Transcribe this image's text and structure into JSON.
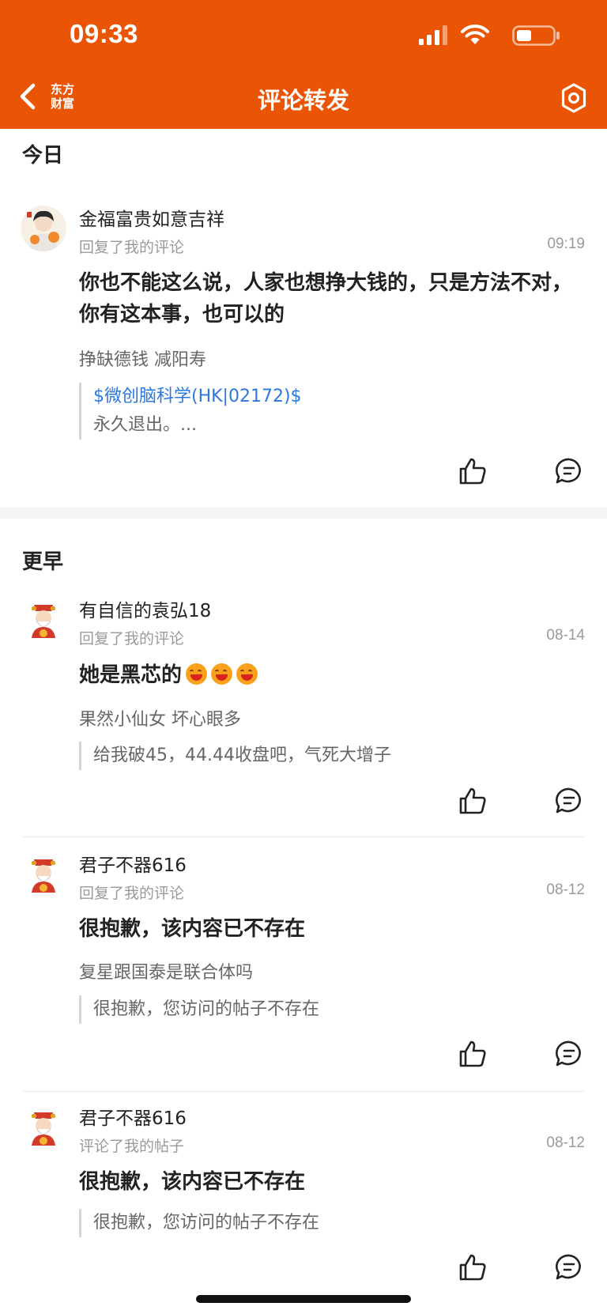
{
  "status_bar": {
    "time": "09:33"
  },
  "nav": {
    "back_icon": "chevron-left-icon",
    "logo_line1": "东方",
    "logo_line2": "财富",
    "title": "评论转发",
    "settings_icon": "gear-icon"
  },
  "colors": {
    "brand": "#ea5405",
    "link": "#2c78e0"
  },
  "sections": {
    "today": "今日",
    "earlier": "更早"
  },
  "items": [
    {
      "user": "金福富贵如意吉祥",
      "action": "回复了我的评论",
      "time": "09:19",
      "comment": "你也不能这么说，人家也想挣大钱的，只是方法不对，你有这本事，也可以的",
      "original": "挣缺德钱 减阳寿",
      "quote_link": "$微创脑科学(HK|02172)$",
      "quote": "永久退出。..."
    },
    {
      "user": "有自信的袁弘18",
      "action": "回复了我的评论",
      "time": "08-14",
      "comment": "她是黑芯的",
      "original": "果然小仙女 坏心眼多",
      "quote": "给我破45，44.44收盘吧，气死大增子"
    },
    {
      "user": "君子不器616",
      "action": "回复了我的评论",
      "time": "08-12",
      "comment": "很抱歉，该内容已不存在",
      "original": "复星跟国泰是联合体吗",
      "quote": "很抱歉，您访问的帖子不存在"
    },
    {
      "user": "君子不器616",
      "action": "评论了我的帖子",
      "time": "08-12",
      "comment": "很抱歉，该内容已不存在",
      "quote": "很抱歉，您访问的帖子不存在"
    }
  ]
}
